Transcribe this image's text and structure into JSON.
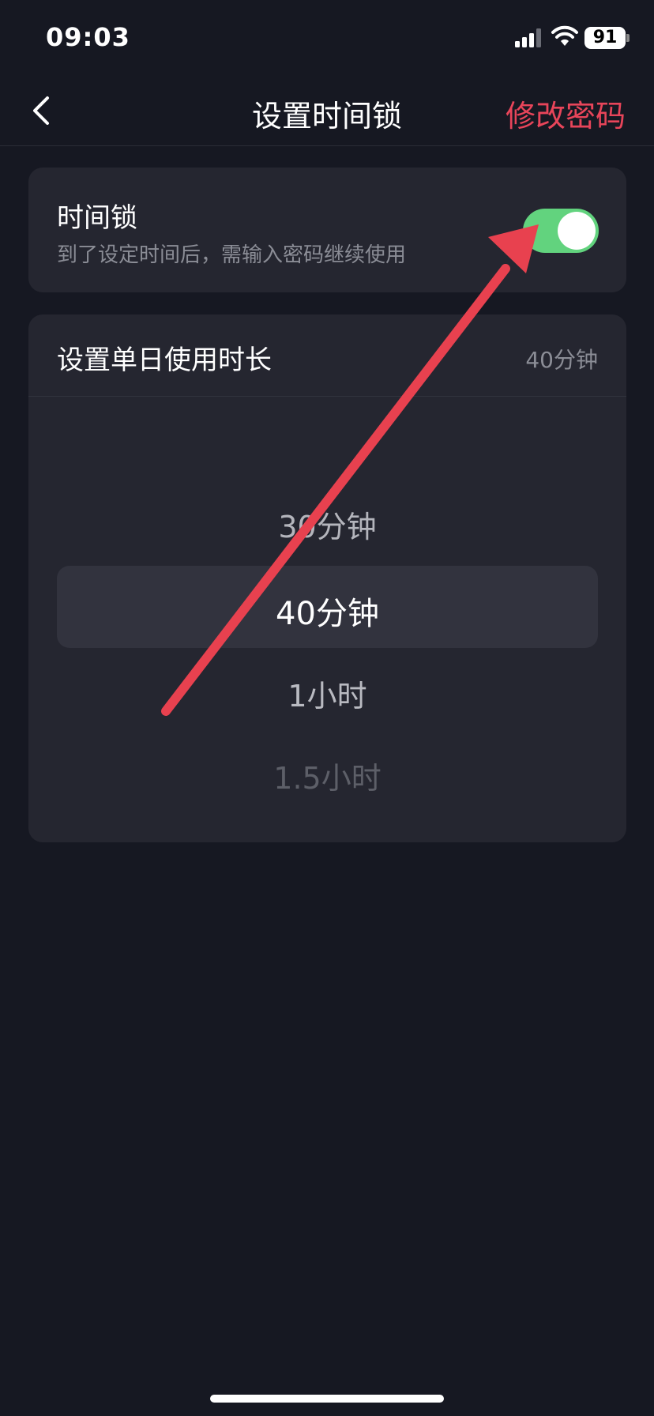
{
  "status_bar": {
    "time": "09:03",
    "battery": "91",
    "icons": [
      "signal-icon",
      "wifi-icon",
      "battery-icon"
    ]
  },
  "nav": {
    "title": "设置时间锁",
    "right_action": "修改密码",
    "back_icon": "chevron-left-icon",
    "accent_color": "#e8455a"
  },
  "time_lock": {
    "title": "时间锁",
    "description": "到了设定时间后，需输入密码继续使用",
    "enabled": true,
    "toggle_color": "#62d37e"
  },
  "daily_duration": {
    "title": "设置单日使用时长",
    "current_value": "40分钟",
    "options": [
      "30分钟",
      "40分钟",
      "1小时",
      "1.5小时"
    ],
    "selected_index": 1
  },
  "annotation": {
    "type": "arrow",
    "color": "#e8414f",
    "points_to": "time-lock-toggle"
  }
}
